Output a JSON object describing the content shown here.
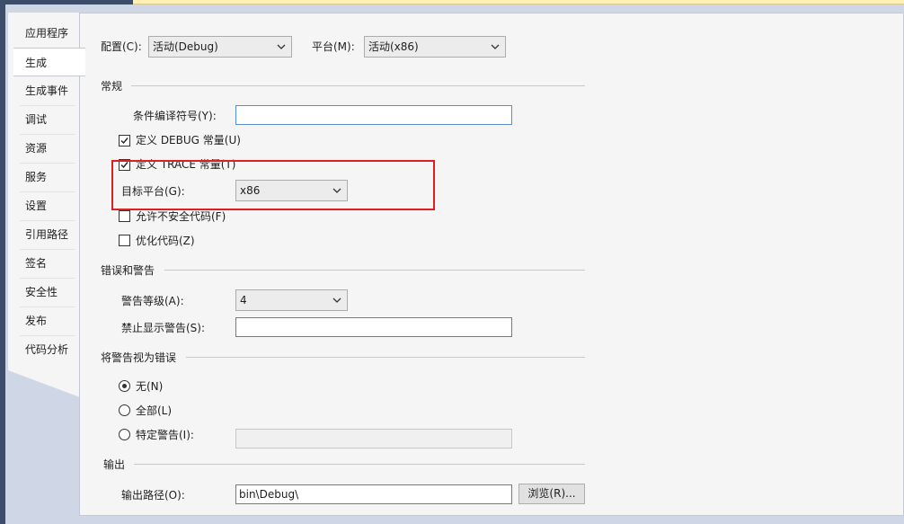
{
  "tabs": [
    {
      "label": "应用程序"
    },
    {
      "label": "生成"
    },
    {
      "label": "生成事件"
    },
    {
      "label": "调试"
    },
    {
      "label": "资源"
    },
    {
      "label": "服务"
    },
    {
      "label": "设置"
    },
    {
      "label": "引用路径"
    },
    {
      "label": "签名"
    },
    {
      "label": "安全性"
    },
    {
      "label": "发布"
    },
    {
      "label": "代码分析"
    }
  ],
  "active_tab": "生成",
  "config": {
    "label": "配置(C):",
    "value": "活动(Debug)"
  },
  "platform": {
    "label": "平台(M):",
    "value": "活动(x86)"
  },
  "general": {
    "title": "常规",
    "conditional_symbols": {
      "label": "条件编译符号(Y):",
      "value": ""
    },
    "define_debug": {
      "label": "定义 DEBUG 常量(U)",
      "checked": true
    },
    "define_trace": {
      "label": "定义 TRACE 常量(T)",
      "checked": true
    },
    "target_platform": {
      "label": "目标平台(G):",
      "value": "x86"
    },
    "allow_unsafe": {
      "label": "允许不安全代码(F)",
      "checked": false
    },
    "optimize": {
      "label": "优化代码(Z)",
      "checked": false
    }
  },
  "errors": {
    "title": "错误和警告",
    "warning_level": {
      "label": "警告等级(A):",
      "value": "4"
    },
    "suppress": {
      "label": "禁止显示警告(S):",
      "value": ""
    }
  },
  "treat_warnings": {
    "title": "将警告视为错误",
    "none": {
      "label": "无(N)",
      "selected": true
    },
    "all": {
      "label": "全部(L)",
      "selected": false
    },
    "specific": {
      "label": "特定警告(I):",
      "selected": false,
      "value": ""
    }
  },
  "output": {
    "title": "输出",
    "path": {
      "label": "输出路径(O):",
      "value": "bin\\Debug\\"
    },
    "browse_label": "浏览(R)..."
  },
  "colors": {
    "highlight": "#e02020",
    "focus_border": "#5a8fc7"
  }
}
